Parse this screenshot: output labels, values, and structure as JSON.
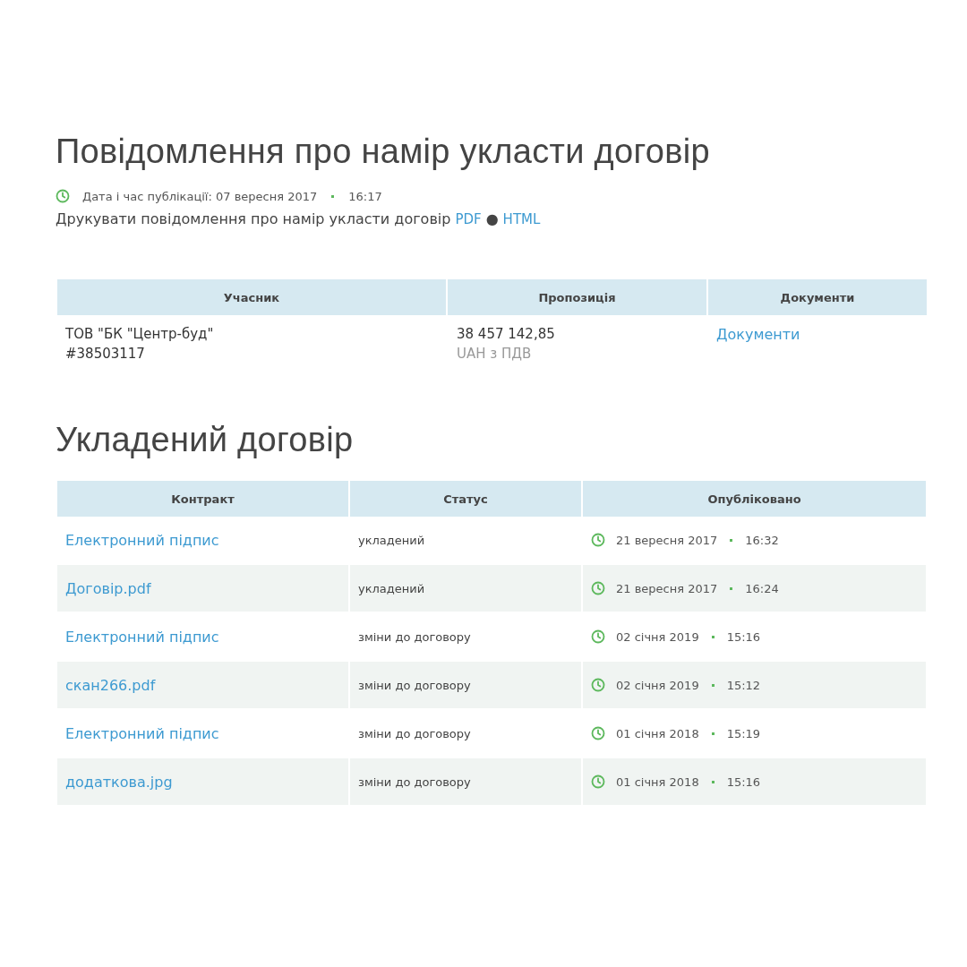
{
  "notice": {
    "title": "Повідомлення про намір укласти договір",
    "published_label": "Дата і час публікації: 07 вересня 2017",
    "published_time": "16:17",
    "print_text": "Друкувати повідомлення про намір укласти договір",
    "print_links": [
      "PDF",
      "HTML"
    ],
    "separator": "●"
  },
  "participants": {
    "columns": [
      "Учасник",
      "Пропозиція",
      "Документи"
    ],
    "rows": [
      {
        "name": "ТОВ \"БК \"Центр-буд\"",
        "code": "#38503117",
        "amount": "38 457 142,85",
        "currency": "UAH з ПДВ",
        "documents": "Документи"
      }
    ]
  },
  "contract": {
    "title": "Укладений договір",
    "columns": [
      "Контракт",
      "Статус",
      "Опубліковано"
    ],
    "rows": [
      {
        "file": "Електронний підпис",
        "status": "укладений",
        "date": "21 вересня 2017",
        "time": "16:32"
      },
      {
        "file": "Договір.pdf",
        "status": "укладений",
        "date": "21 вересня 2017",
        "time": "16:24"
      },
      {
        "file": "Електронний підпис",
        "status": "зміни до договору",
        "date": "02 січня 2019",
        "time": "15:16"
      },
      {
        "file": "скан266.pdf",
        "status": "зміни до договору",
        "date": "02 січня 2019",
        "time": "15:12"
      },
      {
        "file": "Електронний підпис",
        "status": "зміни до договору",
        "date": "01 січня 2018",
        "time": "15:19"
      },
      {
        "file": "додаткова.jpg",
        "status": "зміни до договору",
        "date": "01 січня 2018",
        "time": "15:16"
      }
    ]
  }
}
